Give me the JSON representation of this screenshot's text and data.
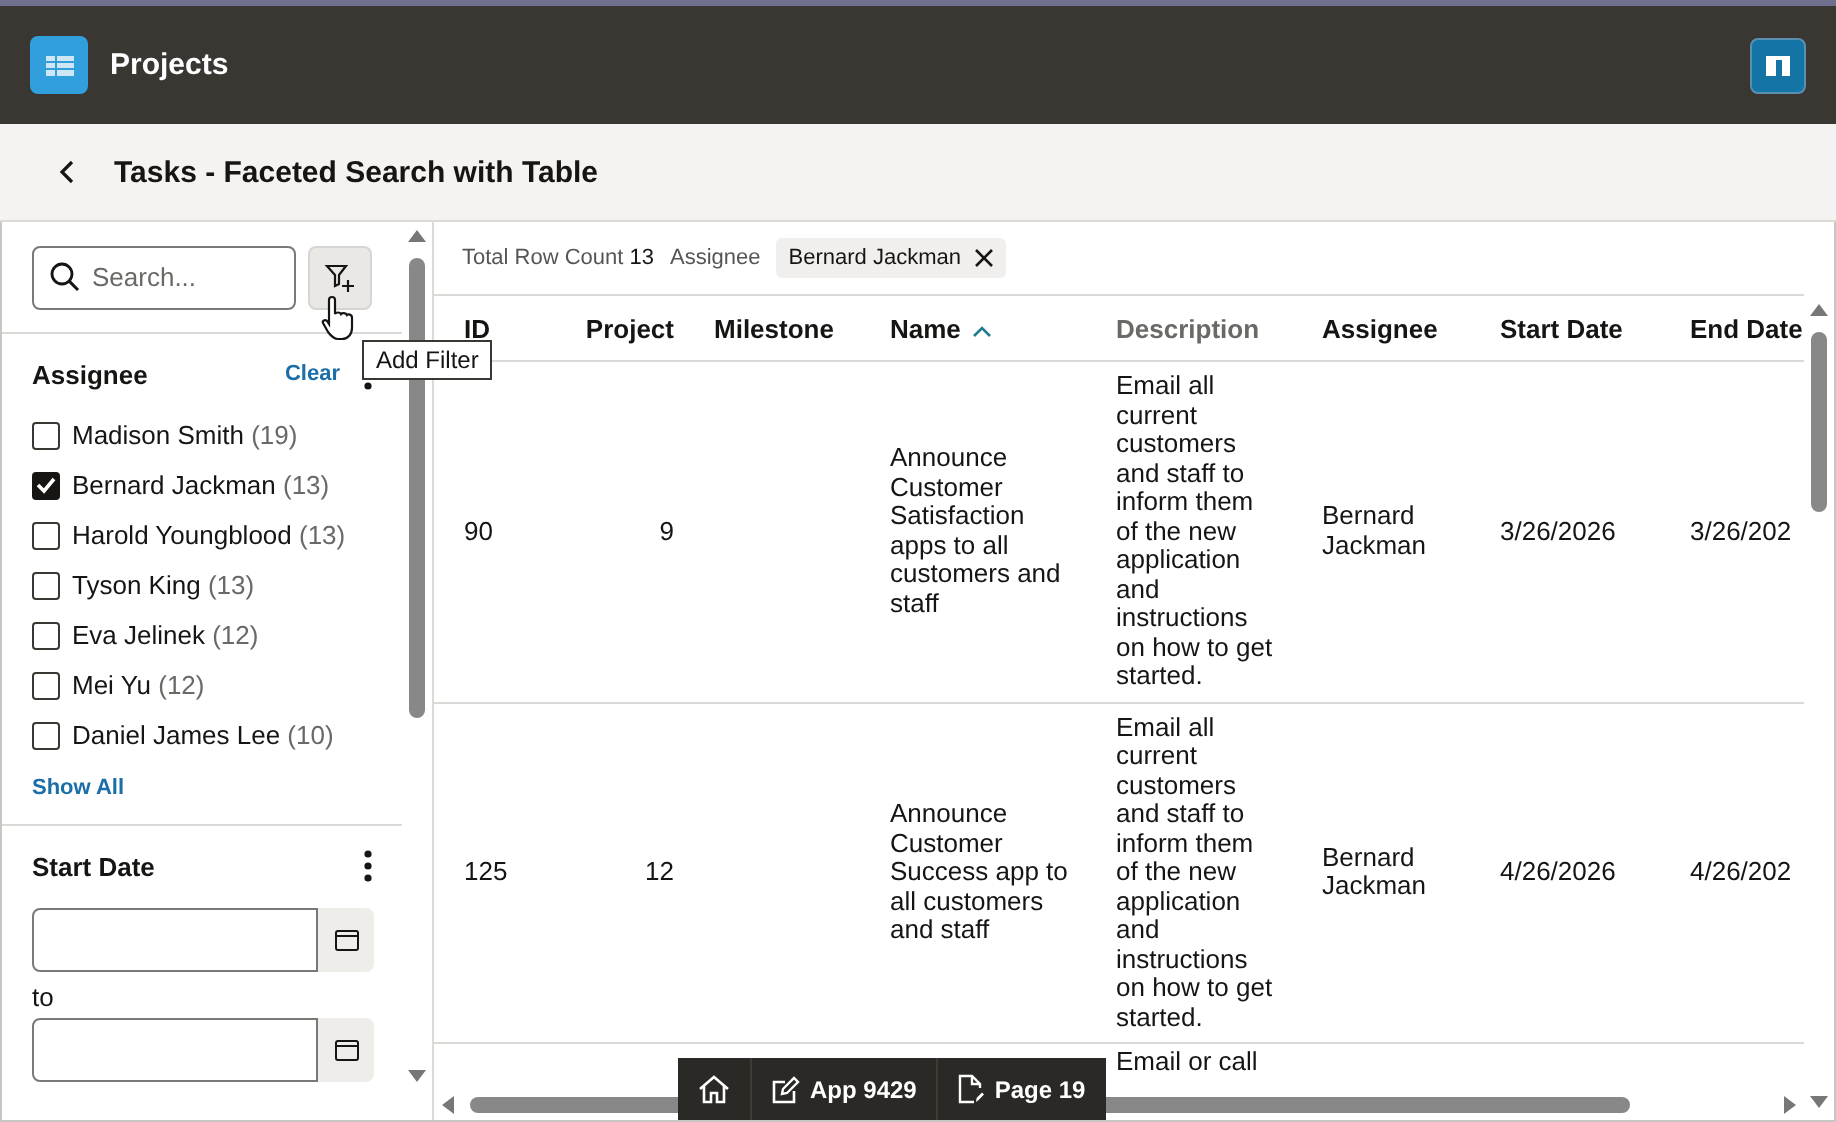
{
  "app": {
    "title": "Projects"
  },
  "page": {
    "title": "Tasks - Faceted Search with Table"
  },
  "search": {
    "placeholder": "Search...",
    "filter_tooltip": "Add Filter"
  },
  "facets": [
    {
      "kind": "checkbox",
      "title": "Assignee",
      "clear": "Clear",
      "show_all": "Show All",
      "options": [
        {
          "label": "Madison Smith",
          "count": "(19)",
          "checked": false
        },
        {
          "label": "Bernard Jackman",
          "count": "(13)",
          "checked": true
        },
        {
          "label": "Harold Youngblood",
          "count": "(13)",
          "checked": false
        },
        {
          "label": "Tyson King",
          "count": "(13)",
          "checked": false
        },
        {
          "label": "Eva Jelinek",
          "count": "(12)",
          "checked": false
        },
        {
          "label": "Mei Yu",
          "count": "(12)",
          "checked": false
        },
        {
          "label": "Daniel James Lee",
          "count": "(10)",
          "checked": false
        }
      ]
    },
    {
      "kind": "date_range",
      "title": "Start Date",
      "to": "to"
    }
  ],
  "summary": {
    "total_label": "Total Row Count",
    "total": "13",
    "filters": [
      {
        "label": "Assignee",
        "value": "Bernard Jackman"
      }
    ]
  },
  "table": {
    "columns": [
      {
        "label": "ID",
        "kind": "id",
        "sortable": true,
        "sorted": false
      },
      {
        "label": "Project",
        "kind": "number",
        "sortable": true,
        "sorted": false
      },
      {
        "label": "Milestone",
        "kind": "text",
        "sortable": true,
        "sorted": false
      },
      {
        "label": "Name",
        "kind": "text",
        "sortable": true,
        "sorted": true
      },
      {
        "label": "Description",
        "kind": "text",
        "sortable": false,
        "sorted": false
      },
      {
        "label": "Assignee",
        "kind": "text",
        "sortable": true,
        "sorted": false
      },
      {
        "label": "Start Date",
        "kind": "date",
        "sortable": true,
        "sorted": false
      },
      {
        "label": "End Date",
        "kind": "date",
        "sortable": true,
        "sorted": false
      }
    ],
    "rows": [
      {
        "cells": [
          "90",
          "9",
          null,
          "Announce Customer Satisfaction apps to all customers and staff",
          "Email all current customers and staff to inform them of the new application and instructions on how to get started.",
          "Bernard Jackman",
          "3/26/2026",
          "3/26/202"
        ]
      },
      {
        "cells": [
          "125",
          "12",
          null,
          "Announce Customer Success app to all customers and staff",
          "Email all current customers and staff to inform them of the new application and instructions on how to get started.",
          "Bernard Jackman",
          "4/26/2026",
          "4/26/202"
        ]
      },
      {
        "cells": [
          null,
          null,
          null,
          null,
          "Email or call",
          null,
          null,
          null
        ]
      }
    ]
  },
  "dev_toolbar": [
    {
      "kind": "home"
    },
    {
      "kind": "app",
      "label": "App 9429"
    },
    {
      "kind": "page",
      "label": "Page 19"
    }
  ]
}
